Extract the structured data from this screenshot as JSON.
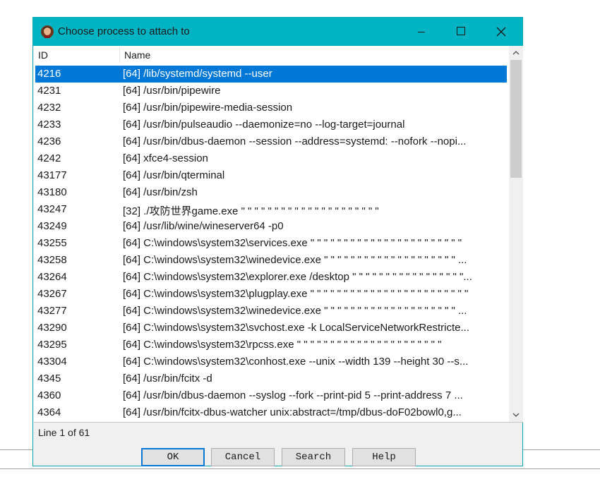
{
  "window": {
    "title": "Choose process to attach to",
    "icon": "app-icon",
    "controls": [
      "minimize-icon",
      "maximize-icon",
      "close-icon"
    ]
  },
  "columns": {
    "id": "ID",
    "name": "Name"
  },
  "processes": [
    {
      "id": "4216",
      "name": "[64] /lib/systemd/systemd --user",
      "selected": true
    },
    {
      "id": "4231",
      "name": "[64] /usr/bin/pipewire"
    },
    {
      "id": "4232",
      "name": "[64] /usr/bin/pipewire-media-session"
    },
    {
      "id": "4233",
      "name": "[64] /usr/bin/pulseaudio --daemonize=no --log-target=journal"
    },
    {
      "id": "4236",
      "name": "[64] /usr/bin/dbus-daemon --session --address=systemd: --nofork --nopi..."
    },
    {
      "id": "4242",
      "name": "[64] xfce4-session"
    },
    {
      "id": "43177",
      "name": "[64] /usr/bin/qterminal"
    },
    {
      "id": "43180",
      "name": "[64] /usr/bin/zsh"
    },
    {
      "id": "43247",
      "name": "[32] ./攻防世界game.exe \" \" \" \" \" \" \" \" \" \" \" \" \" \" \" \" \" \" \" \" \""
    },
    {
      "id": "43249",
      "name": "[64] /usr/lib/wine/wineserver64 -p0"
    },
    {
      "id": "43255",
      "name": "[64] C:\\windows\\system32\\services.exe \" \" \" \" \" \" \" \" \" \" \" \" \" \" \" \" \" \" \" \" \" \" \""
    },
    {
      "id": "43258",
      "name": "[64] C:\\windows\\system32\\winedevice.exe \" \" \" \" \" \" \" \" \" \" \" \" \" \" \" \" \" \" \" \" ..."
    },
    {
      "id": "43264",
      "name": "[64] C:\\windows\\system32\\explorer.exe /desktop \" \" \" \" \" \" \" \" \" \" \" \" \" \" \" \" \"..."
    },
    {
      "id": "43267",
      "name": "[64] C:\\windows\\system32\\plugplay.exe \" \" \" \" \" \" \" \" \" \" \" \" \" \" \" \" \" \" \" \" \" \" \" \""
    },
    {
      "id": "43277",
      "name": "[64] C:\\windows\\system32\\winedevice.exe \" \" \" \" \" \" \" \" \" \" \" \" \" \" \" \" \" \" \" \" ..."
    },
    {
      "id": "43290",
      "name": "[64] C:\\windows\\system32\\svchost.exe -k LocalServiceNetworkRestricte..."
    },
    {
      "id": "43295",
      "name": "[64] C:\\windows\\system32\\rpcss.exe \" \" \" \" \" \" \" \" \" \" \" \" \" \" \" \" \" \" \" \" \" \""
    },
    {
      "id": "43304",
      "name": "[64] C:\\windows\\system32\\conhost.exe --unix --width 139 --height 30 --s..."
    },
    {
      "id": "4345",
      "name": "[64] /usr/bin/fcitx -d"
    },
    {
      "id": "4360",
      "name": "[64] /usr/bin/dbus-daemon --syslog --fork --print-pid 5 --print-address 7 ..."
    },
    {
      "id": "4364",
      "name": "[64] /usr/bin/fcitx-dbus-watcher unix:abstract=/tmp/dbus-doF02bowl0,g..."
    }
  ],
  "status": "Line 1 of 61",
  "buttons": {
    "ok": "OK",
    "cancel": "Cancel",
    "search": "Search",
    "help": "Help"
  },
  "colors": {
    "titlebar": "#00b4c4",
    "selection": "#0078d7",
    "default_button_border": "#0078d7"
  }
}
